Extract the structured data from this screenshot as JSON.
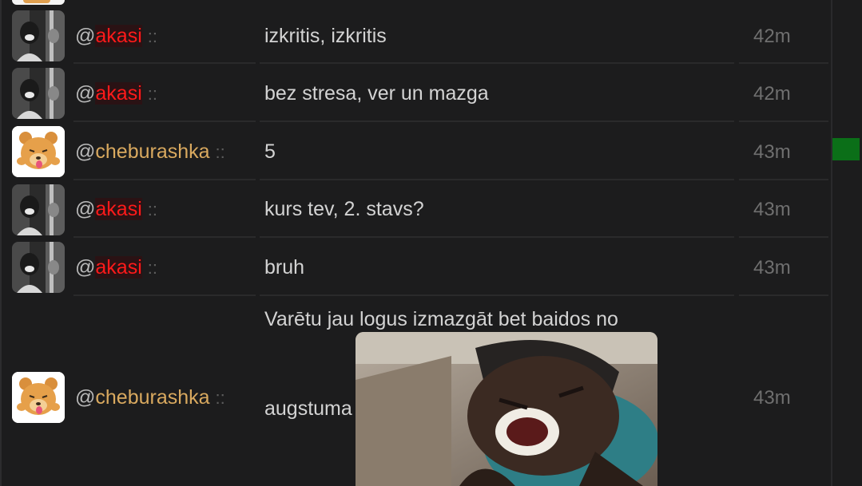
{
  "messages": [
    {
      "user": "akasi",
      "at": "@",
      "separator": "::",
      "text": "izkritis, izkritis",
      "time": "42m"
    },
    {
      "user": "akasi",
      "at": "@",
      "separator": "::",
      "text": "bez stresa, ver un mazga",
      "time": "42m"
    },
    {
      "user": "cheburashka",
      "at": "@",
      "separator": "::",
      "text": "5",
      "time": "43m"
    },
    {
      "user": "akasi",
      "at": "@",
      "separator": "::",
      "text": "kurs tev, 2. stavs?",
      "time": "43m"
    },
    {
      "user": "akasi",
      "at": "@",
      "separator": "::",
      "text": "bruh",
      "time": "43m"
    },
    {
      "user": "cheburashka",
      "at": "@",
      "separator": "::",
      "text_line1": "Varētu jau logus izmazgāt bet baidos no",
      "text_line2": "augstuma",
      "time": "43m",
      "attachment": "gif-image"
    }
  ],
  "colors": {
    "akasi": "#ff1a1a",
    "cheburashka": "#d9a95f",
    "indicator": "#0b6f18"
  },
  "icons": {
    "akasi_avatar": "bw-photo-avatar",
    "cheburashka_avatar": "bear-sticker-avatar"
  }
}
